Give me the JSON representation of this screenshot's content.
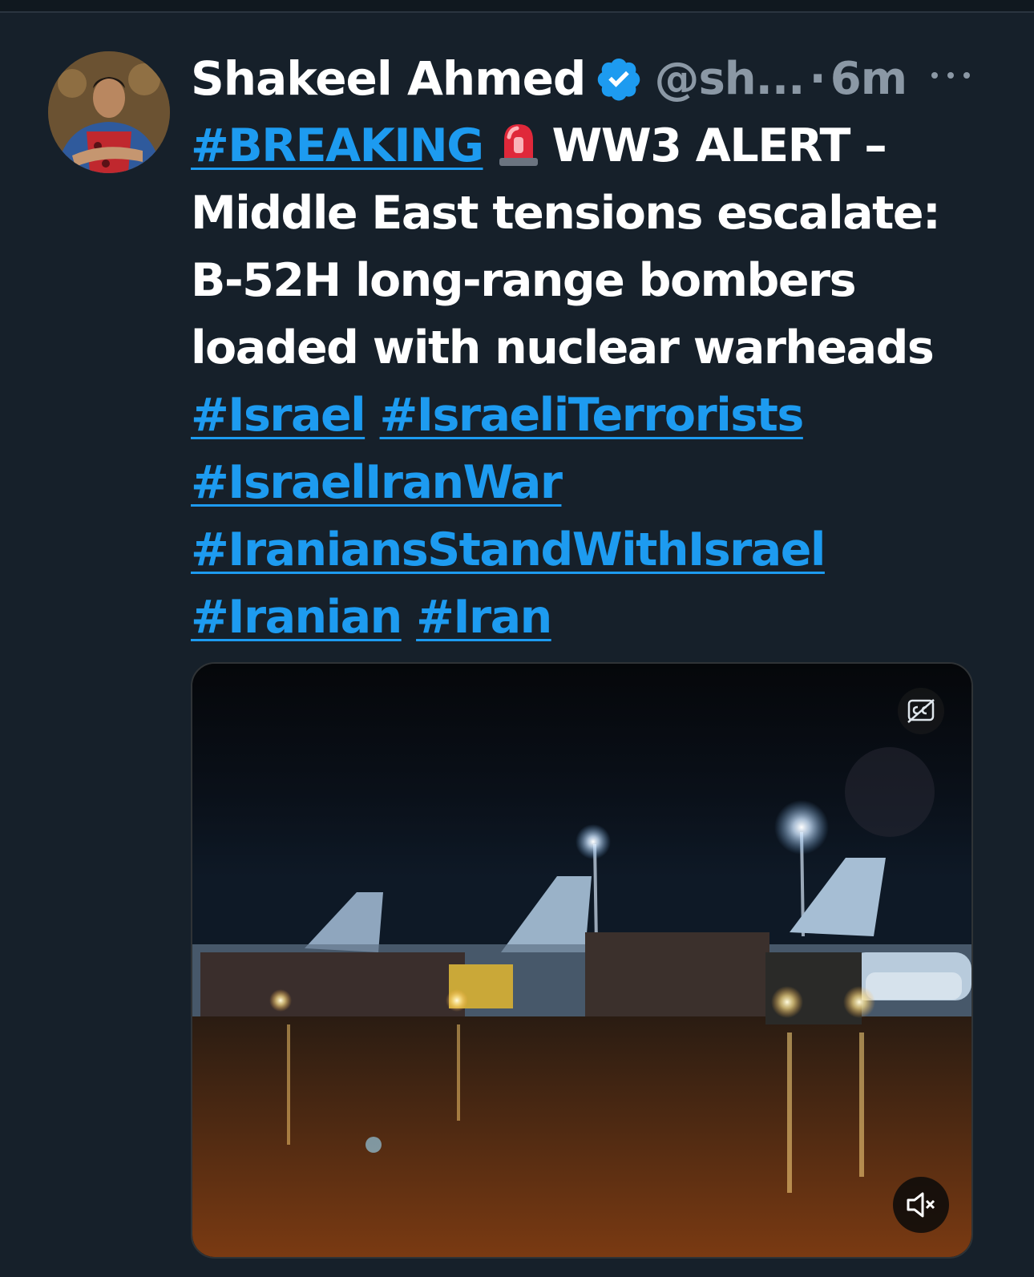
{
  "tweet": {
    "display_name": "Shakeel Ahmed",
    "handle": "@sh...",
    "separator": "·",
    "time": "6m",
    "lines": [
      [
        {
          "text": "#BREAKING",
          "hashtag": true
        },
        {
          "text": "WW3 ALERT –",
          "hashtag": false,
          "after_siren": true
        }
      ],
      [
        {
          "text": "Middle East tensions escalate:",
          "hashtag": false
        }
      ],
      [
        {
          "text": "B-52H long-range bombers",
          "hashtag": false
        }
      ],
      [
        {
          "text": "loaded with nuclear warheads",
          "hashtag": false
        }
      ],
      [
        {
          "text": "#Israel",
          "hashtag": true
        },
        {
          "text": "#IsraeliTerrorists",
          "hashtag": true
        }
      ],
      [
        {
          "text": "#IsraelIranWar",
          "hashtag": true
        }
      ],
      [
        {
          "text": "#IraniansStandWithIsrael",
          "hashtag": true
        }
      ],
      [
        {
          "text": "#Iranian",
          "hashtag": true
        },
        {
          "text": "#Iran",
          "hashtag": true
        }
      ]
    ]
  },
  "colors": {
    "background": "#16202a",
    "hashtag": "#1d9bf0",
    "secondary_text": "#8b98a5",
    "verified": "#1d9bf0"
  },
  "icons": {
    "verified": "verified-badge-icon",
    "siren": "rotating-light-icon",
    "more": "more-horizontal-icon",
    "captions": "captions-off-icon",
    "mute": "volume-muted-icon"
  },
  "media": {
    "type": "video",
    "description_alt": ""
  }
}
